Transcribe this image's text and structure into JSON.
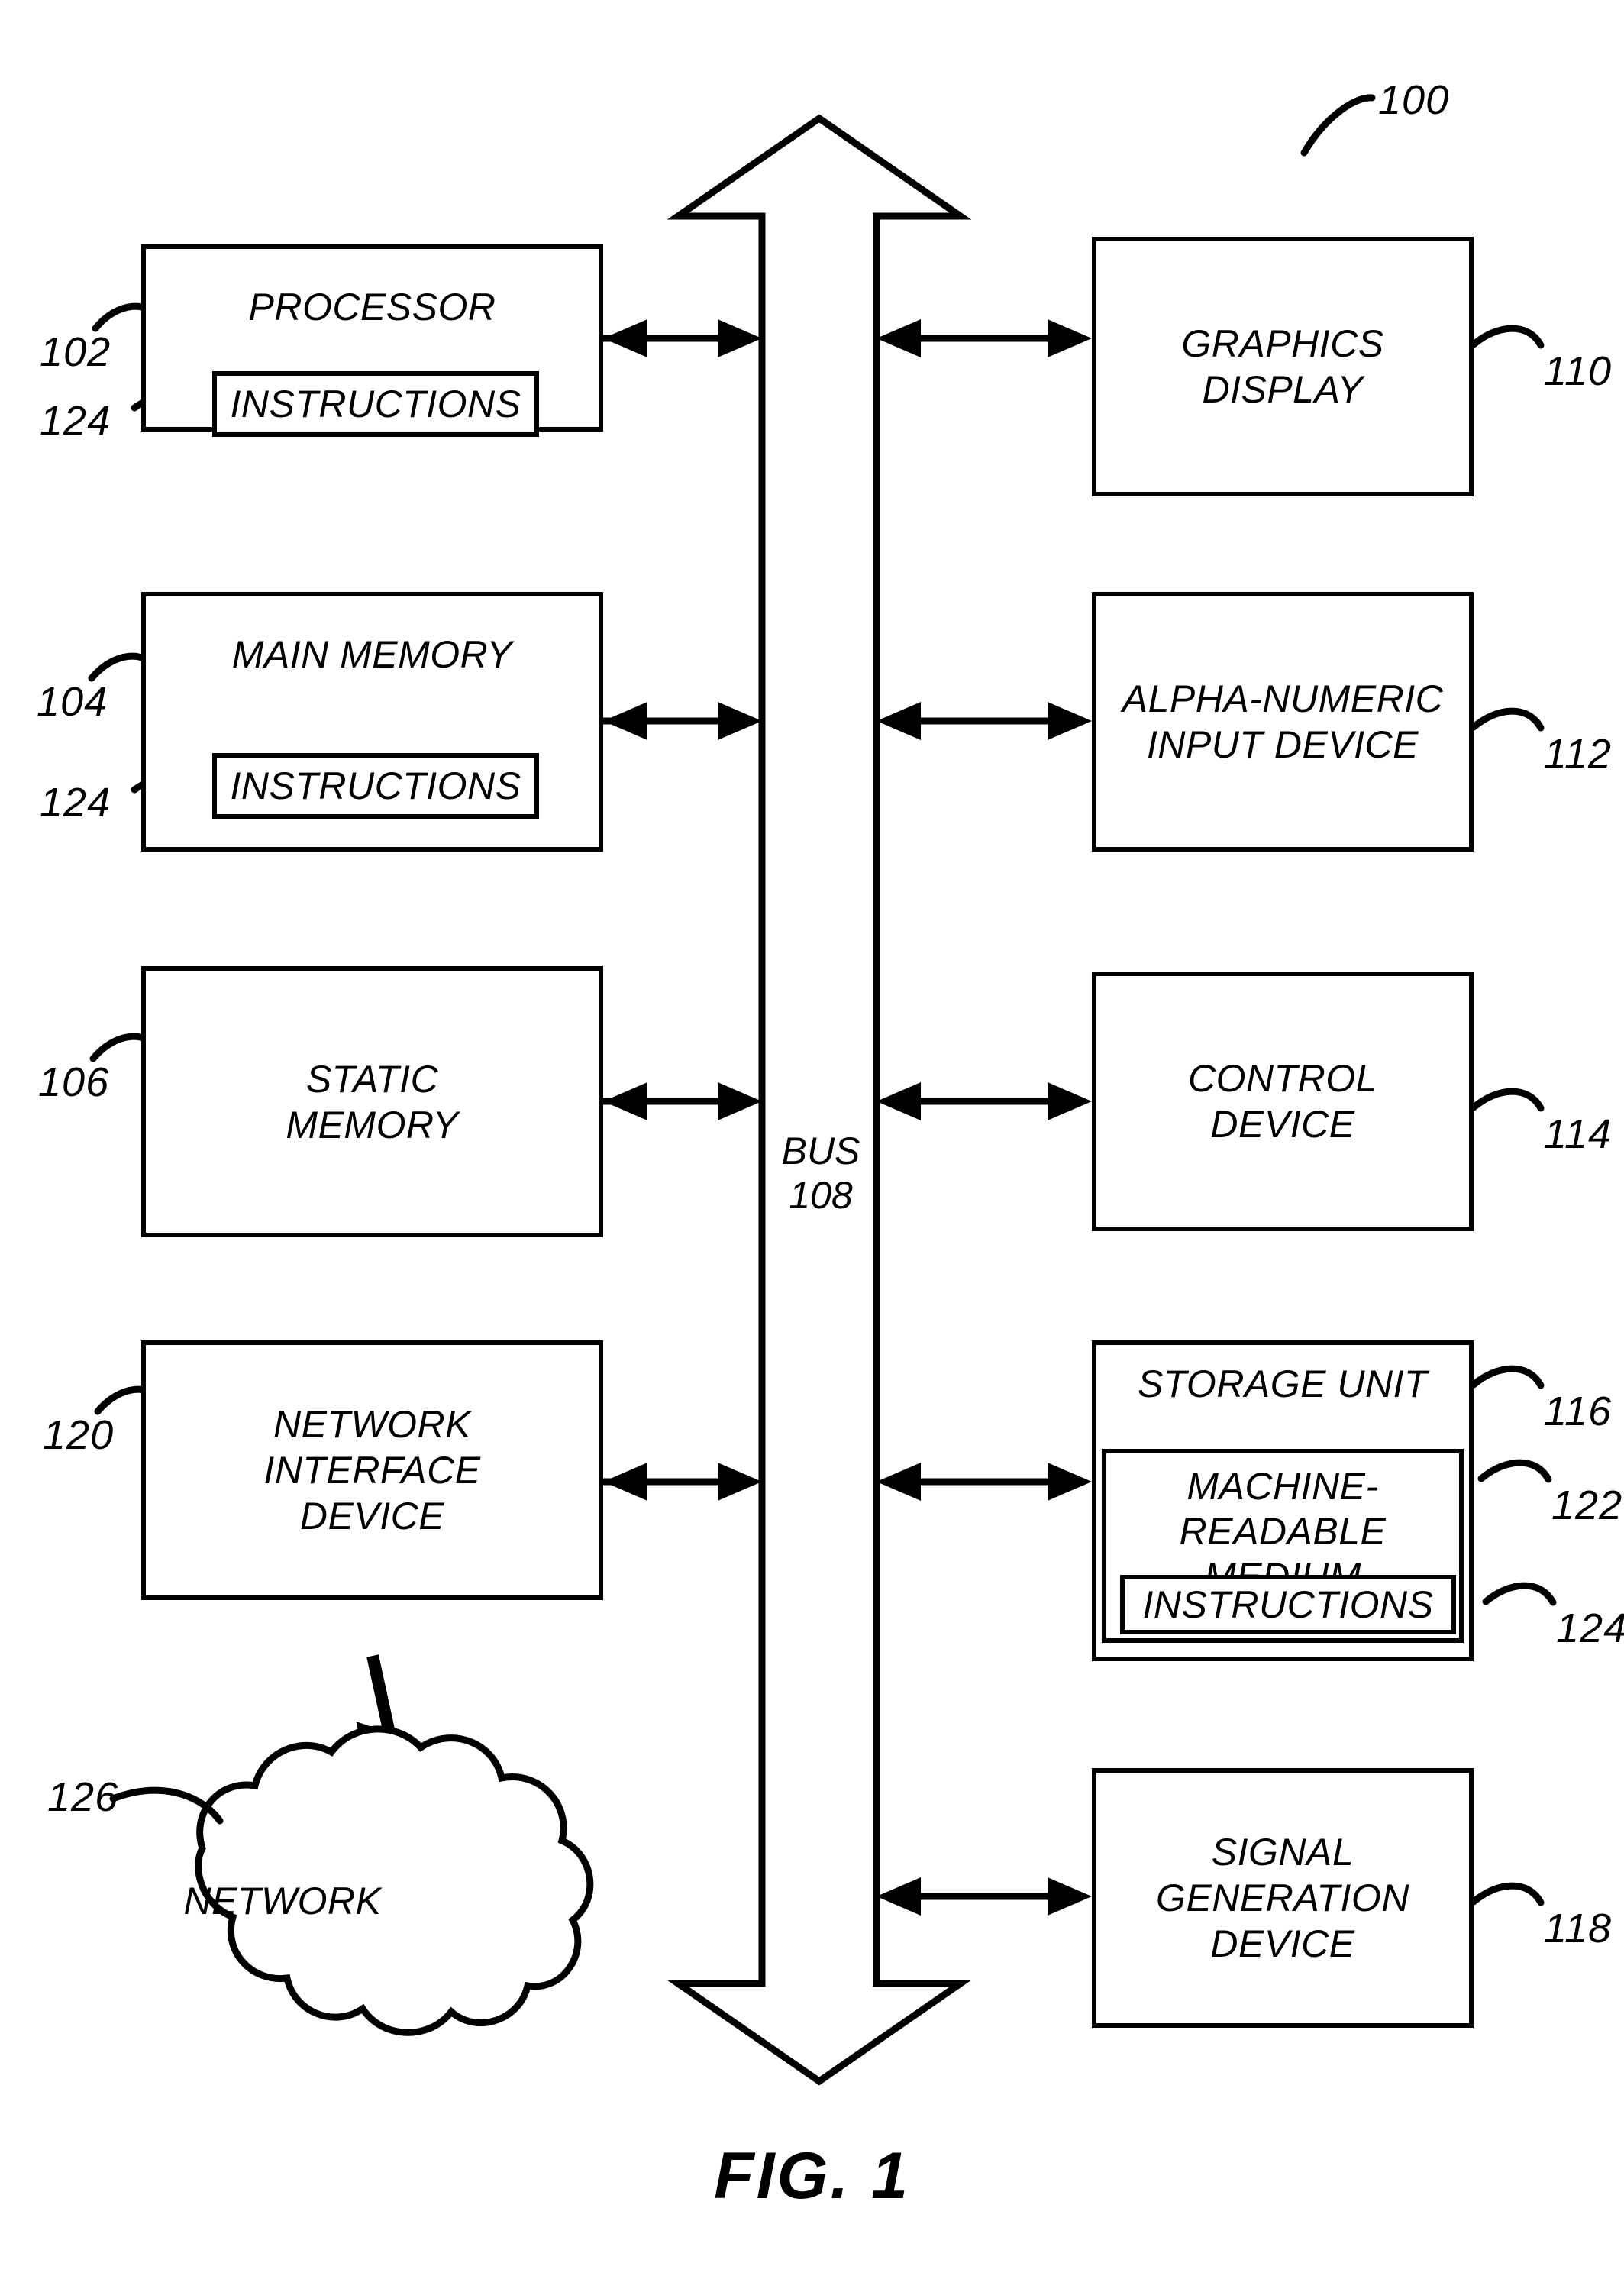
{
  "figure": {
    "caption": "FIG. 1",
    "system_ref": "100"
  },
  "bus": {
    "label": "BUS\n108",
    "name": "BUS",
    "ref": "108"
  },
  "left_column": [
    {
      "label": "PROCESSOR",
      "ref": "102",
      "inner": {
        "label": "INSTRUCTIONS",
        "ref": "124"
      }
    },
    {
      "label": "MAIN MEMORY",
      "ref": "104",
      "inner": {
        "label": "INSTRUCTIONS",
        "ref": "124"
      }
    },
    {
      "label": "STATIC\nMEMORY",
      "ref": "106",
      "inner": null
    },
    {
      "label": "NETWORK\nINTERFACE\nDEVICE",
      "ref": "120",
      "inner": null
    }
  ],
  "right_column": [
    {
      "label": "GRAPHICS\nDISPLAY",
      "ref": "110"
    },
    {
      "label": "ALPHA-NUMERIC\nINPUT DEVICE",
      "ref": "112"
    },
    {
      "label": "CONTROL\nDEVICE",
      "ref": "114"
    },
    {
      "label": "STORAGE UNIT",
      "ref": "116",
      "medium": {
        "label": "MACHINE-\nREADABLE\nMEDIUM",
        "ref": "122",
        "inner": {
          "label": "INSTRUCTIONS",
          "ref": "124"
        }
      }
    },
    {
      "label": "SIGNAL\nGENERATION\nDEVICE",
      "ref": "118"
    }
  ],
  "network": {
    "label": "NETWORK",
    "ref": "126"
  },
  "colors": {
    "stroke": "#000000",
    "background": "#ffffff"
  }
}
